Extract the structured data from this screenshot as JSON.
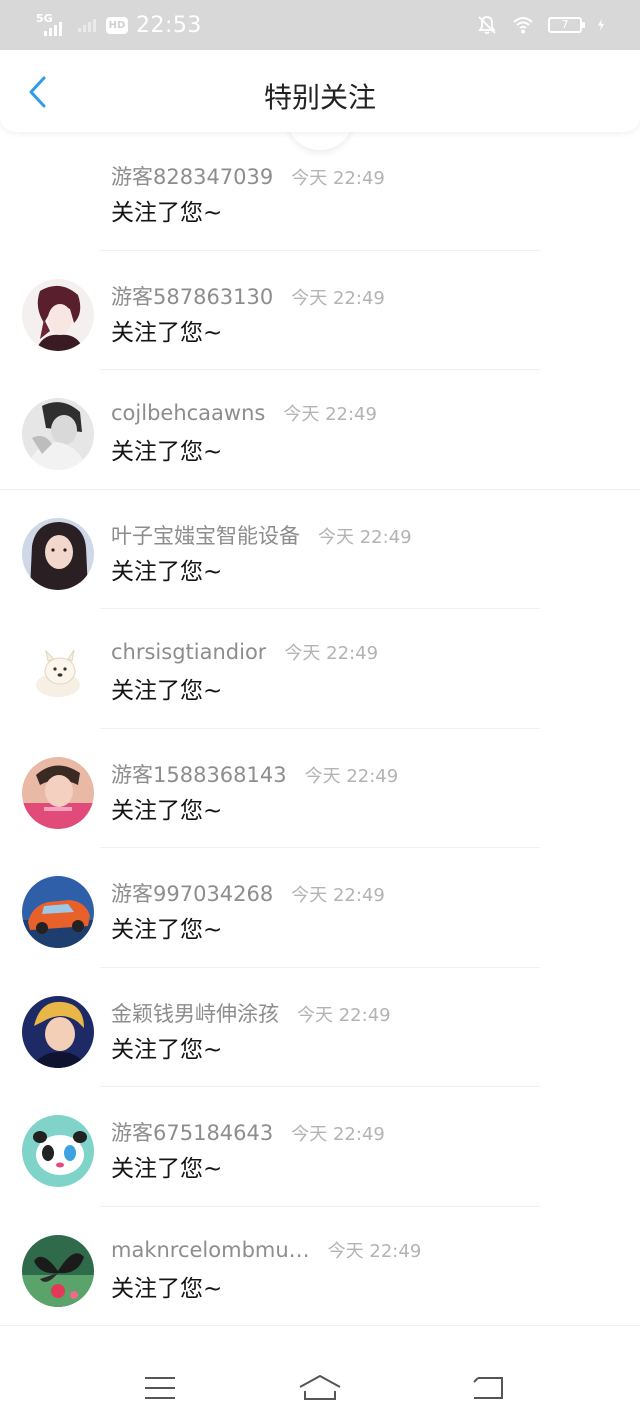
{
  "status_bar": {
    "network": "5G",
    "hd": "HD",
    "time": "22:53",
    "battery": "7"
  },
  "header": {
    "title": "特别关注"
  },
  "colors": {
    "accent": "#2f9be8",
    "status_bar_bg": "#d8d8d8",
    "username": "#8d8d8d",
    "timestamp": "#b3b3b3",
    "message": "#151515"
  },
  "notifications": [
    {
      "username": "游客828347039",
      "time": "今天 22:49",
      "message": "关注了您~",
      "avatar": "none"
    },
    {
      "username": "游客587863130",
      "time": "今天 22:49",
      "message": "关注了您~",
      "avatar": "anime-character-sketch"
    },
    {
      "username": "cojlbehcaawns",
      "time": "今天 22:49",
      "message": "关注了您~",
      "avatar": "grayscale-girl-photo"
    },
    {
      "username": "叶子宝媸宝智能设备",
      "time": "今天 22:49",
      "message": "关注了您~",
      "avatar": "long-hair-girl-photo"
    },
    {
      "username": "chrsisgtiandior",
      "time": "今天 22:49",
      "message": "关注了您~",
      "avatar": "white-dog-cartoon"
    },
    {
      "username": "游客1588368143",
      "time": "今天 22:49",
      "message": "关注了您~",
      "avatar": "young-man-photo"
    },
    {
      "username": "游客997034268",
      "time": "今天 22:49",
      "message": "关注了您~",
      "avatar": "orange-car-photo"
    },
    {
      "username": "金颖钱男峙伸涂孩",
      "time": "今天 22:49",
      "message": "关注了您~",
      "avatar": "blond-boy-photo"
    },
    {
      "username": "游客675184643",
      "time": "今天 22:49",
      "message": "关注了您~",
      "avatar": "panda-cartoon"
    },
    {
      "username": "maknrcelombmu…",
      "time": "今天 22:49",
      "message": "关注了您~",
      "avatar": "butterfly-flower-photo"
    }
  ],
  "nav": {
    "buttons": [
      "menu-icon",
      "home-icon",
      "back-icon"
    ]
  }
}
